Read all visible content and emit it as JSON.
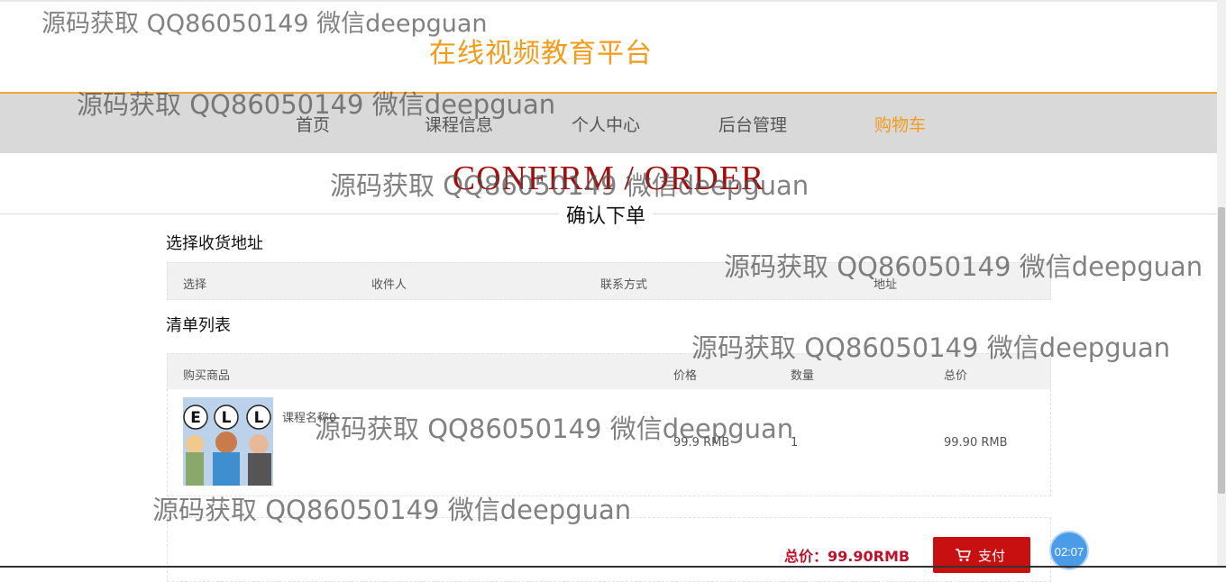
{
  "header": {
    "site_title": "在线视频教育平台"
  },
  "nav": {
    "items": [
      "首页",
      "课程信息",
      "个人中心",
      "后台管理",
      "购物车"
    ],
    "active_index": 4
  },
  "hero": {
    "title_en": "CONFIRM / ORDER",
    "title_cn": "确认下单"
  },
  "address_section": {
    "title": "选择收货地址",
    "columns": [
      "选择",
      "收件人",
      "联系方式",
      "地址"
    ]
  },
  "list_section": {
    "title": "清单列表",
    "columns": [
      "购买商品",
      "价格",
      "数量",
      "总价"
    ],
    "items": [
      {
        "name": "课程名称0",
        "price": "99.9 RMB",
        "quantity": "1",
        "subtotal": "99.90 RMB",
        "thumb_letters": [
          "E",
          "L",
          "L"
        ]
      }
    ]
  },
  "footer": {
    "total_label": "总价：",
    "total_value": "99.90RMB",
    "pay_label": "支付",
    "pay_icon": "cart-icon"
  },
  "timer": "02:07",
  "watermark": "源码获取 QQ86050149 微信deepguan",
  "colors": {
    "accent": "#f29b1d",
    "brand_red": "#c81010",
    "nav_bg": "#d9d9d9"
  }
}
